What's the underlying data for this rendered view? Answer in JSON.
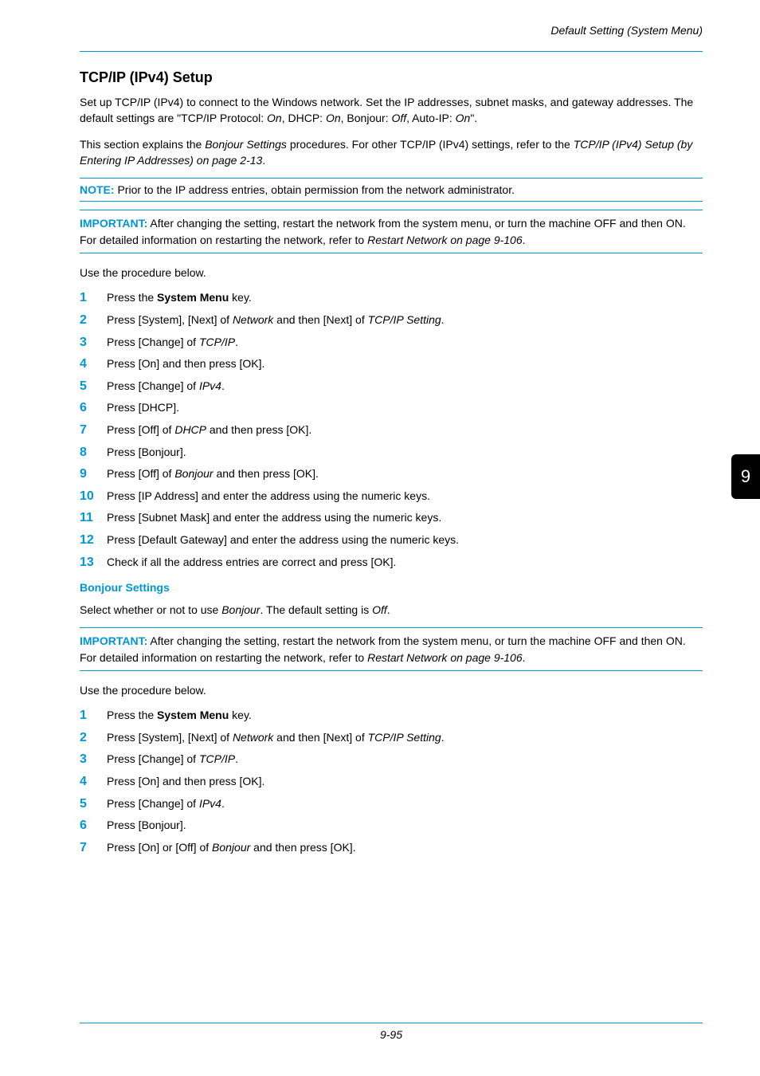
{
  "header": {
    "running": "Default Setting (System Menu)"
  },
  "sideTab": "9",
  "title": "TCP/IP (IPv4) Setup",
  "intro1_a": "Set up TCP/IP (IPv4) to connect to the Windows network. Set the IP addresses, subnet masks, and gateway addresses. The default settings are \"TCP/IP Protocol: ",
  "intro1_on1": "On",
  "intro1_b": ", DHCP: ",
  "intro1_on2": "On",
  "intro1_c": ", Bonjour: ",
  "intro1_off": "Off",
  "intro1_d": ", Auto-IP: ",
  "intro1_on3": "On",
  "intro1_e": "\".",
  "intro2_a": "This section explains the ",
  "intro2_b": "Bonjour Settings",
  "intro2_c": " procedures. For other TCP/IP (IPv4) settings, refer to the ",
  "intro2_d": "TCP/IP (IPv4) Setup (by Entering IP Addresses) on page 2-13",
  "intro2_e": ".",
  "note_label": "NOTE:",
  "note_body": " Prior to the IP address entries, obtain permission from the network administrator.",
  "important_label": "IMPORTANT:",
  "important_body_a": " After changing the setting, restart the network from the system menu, or turn the machine OFF and then ON. For detailed information on restarting the network, refer to ",
  "important_body_b": "Restart Network on page 9-106",
  "important_body_c": ".",
  "use_below": "Use the procedure below.",
  "steps1": [
    {
      "num": "1",
      "pre": "Press the ",
      "bold": "System Menu",
      "post": " key."
    },
    {
      "num": "2",
      "pre": "Press [System], [Next] of ",
      "ital1": "Network",
      "mid": " and then [Next] of ",
      "ital2": "TCP/IP Setting",
      "post": "."
    },
    {
      "num": "3",
      "pre": "Press [Change] of ",
      "ital1": "TCP/IP",
      "post": "."
    },
    {
      "num": "4",
      "pre": "Press [On] and then press [OK]."
    },
    {
      "num": "5",
      "pre": "Press [Change] of ",
      "ital1": "IPv4",
      "post": "."
    },
    {
      "num": "6",
      "pre": "Press [DHCP]."
    },
    {
      "num": "7",
      "pre": "Press [Off] of ",
      "ital1": "DHCP",
      "post": " and then press [OK]."
    },
    {
      "num": "8",
      "pre": "Press [Bonjour]."
    },
    {
      "num": "9",
      "pre": "Press [Off] of ",
      "ital1": "Bonjour",
      "post": " and then press [OK]."
    },
    {
      "num": "10",
      "pre": "Press [IP Address] and enter the address using the numeric keys."
    },
    {
      "num": "11",
      "pre": "Press [Subnet Mask] and enter the address using the numeric keys."
    },
    {
      "num": "12",
      "pre": "Press [Default Gateway] and enter the address using the numeric keys."
    },
    {
      "num": "13",
      "pre": "Check if all the address entries are correct and press [OK]."
    }
  ],
  "bonjour_heading": "Bonjour Settings",
  "bonjour_para_a": "Select whether or not to use ",
  "bonjour_para_b": "Bonjour",
  "bonjour_para_c": ". The default setting is ",
  "bonjour_para_d": "Off",
  "bonjour_para_e": ".",
  "steps2": [
    {
      "num": "1",
      "pre": "Press the ",
      "bold": "System Menu",
      "post": " key."
    },
    {
      "num": "2",
      "pre": "Press [System], [Next] of ",
      "ital1": "Network",
      "mid": " and then [Next] of ",
      "ital2": "TCP/IP Setting",
      "post": "."
    },
    {
      "num": "3",
      "pre": "Press [Change] of ",
      "ital1": "TCP/IP",
      "post": "."
    },
    {
      "num": "4",
      "pre": "Press [On] and then press [OK]."
    },
    {
      "num": "5",
      "pre": "Press [Change] of ",
      "ital1": "IPv4",
      "post": "."
    },
    {
      "num": "6",
      "pre": "Press [Bonjour]."
    },
    {
      "num": "7",
      "pre": "Press [On] or [Off] of ",
      "ital1": "Bonjour",
      "post": " and then press [OK]."
    }
  ],
  "footer": "9-95"
}
